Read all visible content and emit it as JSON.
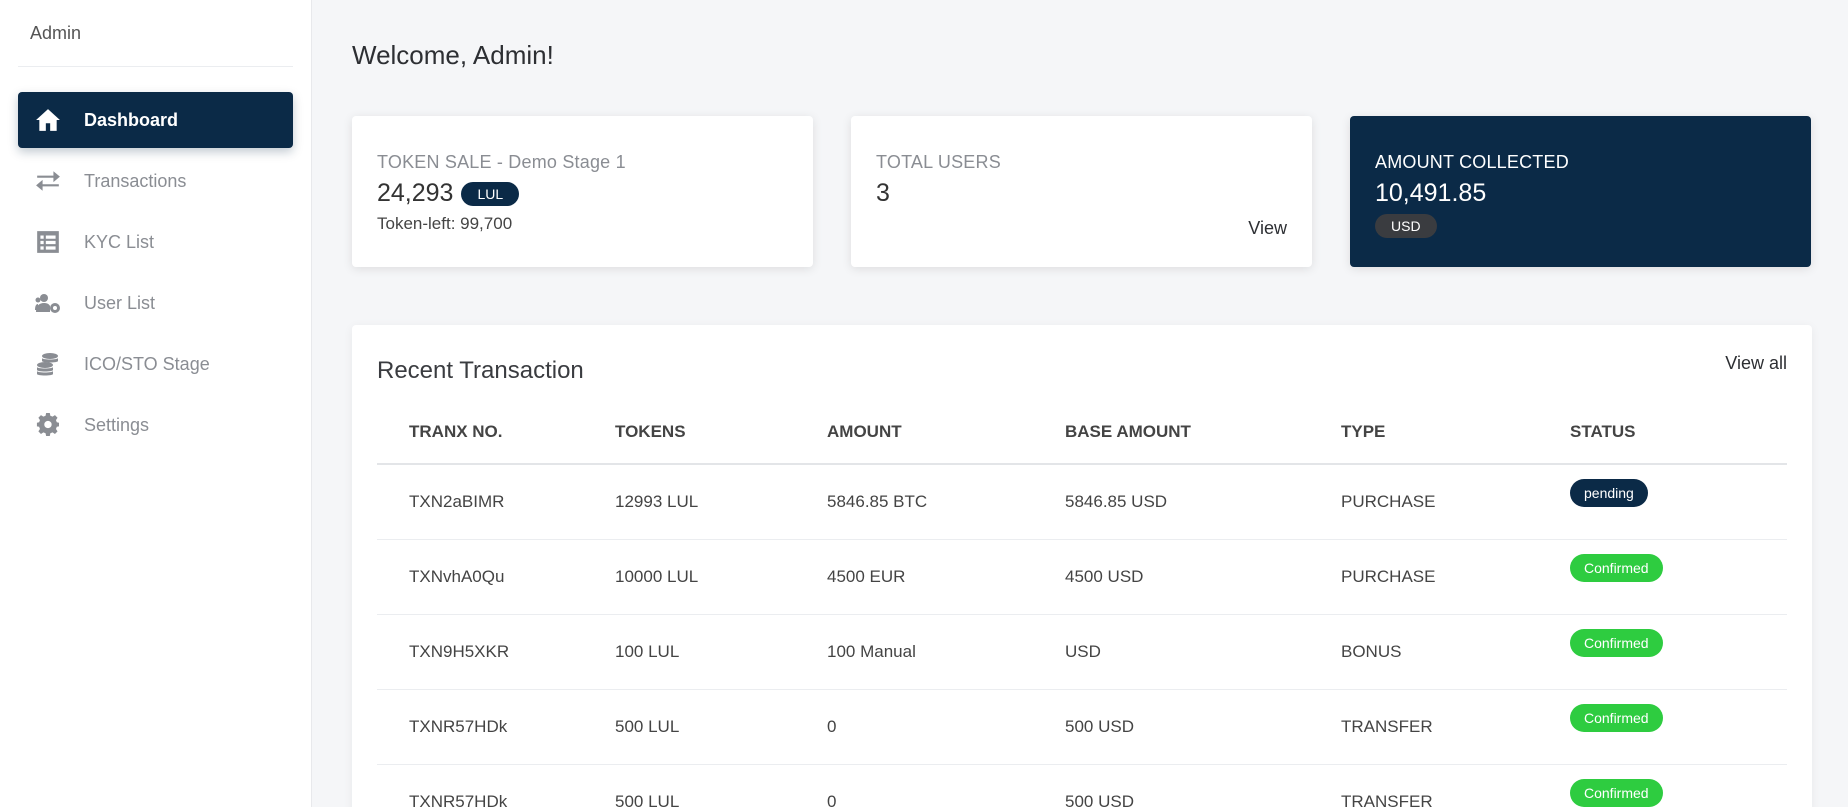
{
  "sidebar": {
    "brand": "Admin",
    "items": [
      {
        "label": "Dashboard",
        "icon": "home-icon",
        "active": true
      },
      {
        "label": "Transactions",
        "icon": "exchange-icon"
      },
      {
        "label": "KYC List",
        "icon": "list-icon"
      },
      {
        "label": "User List",
        "icon": "users-cog-icon"
      },
      {
        "label": "ICO/STO Stage",
        "icon": "coins-icon"
      },
      {
        "label": "Settings",
        "icon": "gear-icon"
      }
    ]
  },
  "main": {
    "welcome": "Welcome, Admin!",
    "cards": {
      "token_sale": {
        "title": "TOKEN SALE - Demo Stage 1",
        "value": "24,293",
        "badge": "LUL",
        "sub": "Token-left: 99,700"
      },
      "total_users": {
        "title": "TOTAL USERS",
        "value": "3",
        "link": "View"
      },
      "amount_collected": {
        "title": "AMOUNT COLLECTED",
        "value": "10,491.85",
        "badge": "USD"
      }
    },
    "recent": {
      "title": "Recent Transaction",
      "view_all": "View all",
      "columns": [
        "TRANX NO.",
        "TOKENS",
        "AMOUNT",
        "BASE AMOUNT",
        "TYPE",
        "STATUS"
      ],
      "rows": [
        {
          "tranx": "TXN2aBIMR",
          "tokens": "12993 LUL",
          "amount": "5846.85 BTC",
          "base": "5846.85 USD",
          "type": "PURCHASE",
          "status": "pending"
        },
        {
          "tranx": "TXNvhA0Qu",
          "tokens": "10000 LUL",
          "amount": "4500 EUR",
          "base": "4500 USD",
          "type": "PURCHASE",
          "status": "Confirmed"
        },
        {
          "tranx": "TXN9H5XKR",
          "tokens": "100 LUL",
          "amount": "100 Manual",
          "base": "USD",
          "type": "BONUS",
          "status": "Confirmed"
        },
        {
          "tranx": "TXNR57HDk",
          "tokens": "500 LUL",
          "amount": "0",
          "base": "500 USD",
          "type": "TRANSFER",
          "status": "Confirmed"
        },
        {
          "tranx": "TXNR57HDk",
          "tokens": "500 LUL",
          "amount": "0",
          "base": "500 USD",
          "type": "TRANSFER",
          "status": "Confirmed"
        }
      ]
    }
  },
  "colors": {
    "primary": "#0b2a47",
    "confirmed": "#2ecc40",
    "background": "#f5f6f8"
  }
}
